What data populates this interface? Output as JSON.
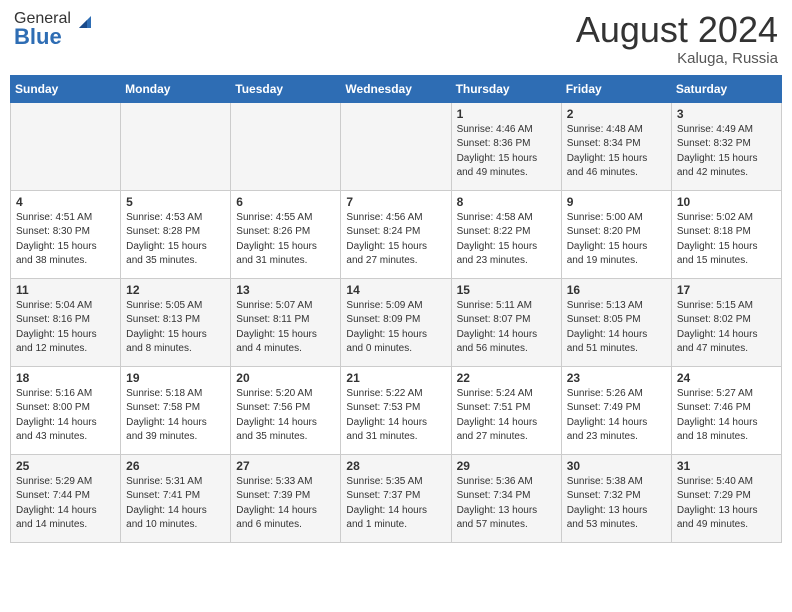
{
  "header": {
    "logo_line1": "General",
    "logo_line2": "Blue",
    "month_title": "August 2024",
    "location": "Kaluga, Russia"
  },
  "weekdays": [
    "Sunday",
    "Monday",
    "Tuesday",
    "Wednesday",
    "Thursday",
    "Friday",
    "Saturday"
  ],
  "weeks": [
    [
      {
        "day": "",
        "info": ""
      },
      {
        "day": "",
        "info": ""
      },
      {
        "day": "",
        "info": ""
      },
      {
        "day": "",
        "info": ""
      },
      {
        "day": "1",
        "info": "Sunrise: 4:46 AM\nSunset: 8:36 PM\nDaylight: 15 hours\nand 49 minutes."
      },
      {
        "day": "2",
        "info": "Sunrise: 4:48 AM\nSunset: 8:34 PM\nDaylight: 15 hours\nand 46 minutes."
      },
      {
        "day": "3",
        "info": "Sunrise: 4:49 AM\nSunset: 8:32 PM\nDaylight: 15 hours\nand 42 minutes."
      }
    ],
    [
      {
        "day": "4",
        "info": "Sunrise: 4:51 AM\nSunset: 8:30 PM\nDaylight: 15 hours\nand 38 minutes."
      },
      {
        "day": "5",
        "info": "Sunrise: 4:53 AM\nSunset: 8:28 PM\nDaylight: 15 hours\nand 35 minutes."
      },
      {
        "day": "6",
        "info": "Sunrise: 4:55 AM\nSunset: 8:26 PM\nDaylight: 15 hours\nand 31 minutes."
      },
      {
        "day": "7",
        "info": "Sunrise: 4:56 AM\nSunset: 8:24 PM\nDaylight: 15 hours\nand 27 minutes."
      },
      {
        "day": "8",
        "info": "Sunrise: 4:58 AM\nSunset: 8:22 PM\nDaylight: 15 hours\nand 23 minutes."
      },
      {
        "day": "9",
        "info": "Sunrise: 5:00 AM\nSunset: 8:20 PM\nDaylight: 15 hours\nand 19 minutes."
      },
      {
        "day": "10",
        "info": "Sunrise: 5:02 AM\nSunset: 8:18 PM\nDaylight: 15 hours\nand 15 minutes."
      }
    ],
    [
      {
        "day": "11",
        "info": "Sunrise: 5:04 AM\nSunset: 8:16 PM\nDaylight: 15 hours\nand 12 minutes."
      },
      {
        "day": "12",
        "info": "Sunrise: 5:05 AM\nSunset: 8:13 PM\nDaylight: 15 hours\nand 8 minutes."
      },
      {
        "day": "13",
        "info": "Sunrise: 5:07 AM\nSunset: 8:11 PM\nDaylight: 15 hours\nand 4 minutes."
      },
      {
        "day": "14",
        "info": "Sunrise: 5:09 AM\nSunset: 8:09 PM\nDaylight: 15 hours\nand 0 minutes."
      },
      {
        "day": "15",
        "info": "Sunrise: 5:11 AM\nSunset: 8:07 PM\nDaylight: 14 hours\nand 56 minutes."
      },
      {
        "day": "16",
        "info": "Sunrise: 5:13 AM\nSunset: 8:05 PM\nDaylight: 14 hours\nand 51 minutes."
      },
      {
        "day": "17",
        "info": "Sunrise: 5:15 AM\nSunset: 8:02 PM\nDaylight: 14 hours\nand 47 minutes."
      }
    ],
    [
      {
        "day": "18",
        "info": "Sunrise: 5:16 AM\nSunset: 8:00 PM\nDaylight: 14 hours\nand 43 minutes."
      },
      {
        "day": "19",
        "info": "Sunrise: 5:18 AM\nSunset: 7:58 PM\nDaylight: 14 hours\nand 39 minutes."
      },
      {
        "day": "20",
        "info": "Sunrise: 5:20 AM\nSunset: 7:56 PM\nDaylight: 14 hours\nand 35 minutes."
      },
      {
        "day": "21",
        "info": "Sunrise: 5:22 AM\nSunset: 7:53 PM\nDaylight: 14 hours\nand 31 minutes."
      },
      {
        "day": "22",
        "info": "Sunrise: 5:24 AM\nSunset: 7:51 PM\nDaylight: 14 hours\nand 27 minutes."
      },
      {
        "day": "23",
        "info": "Sunrise: 5:26 AM\nSunset: 7:49 PM\nDaylight: 14 hours\nand 23 minutes."
      },
      {
        "day": "24",
        "info": "Sunrise: 5:27 AM\nSunset: 7:46 PM\nDaylight: 14 hours\nand 18 minutes."
      }
    ],
    [
      {
        "day": "25",
        "info": "Sunrise: 5:29 AM\nSunset: 7:44 PM\nDaylight: 14 hours\nand 14 minutes."
      },
      {
        "day": "26",
        "info": "Sunrise: 5:31 AM\nSunset: 7:41 PM\nDaylight: 14 hours\nand 10 minutes."
      },
      {
        "day": "27",
        "info": "Sunrise: 5:33 AM\nSunset: 7:39 PM\nDaylight: 14 hours\nand 6 minutes."
      },
      {
        "day": "28",
        "info": "Sunrise: 5:35 AM\nSunset: 7:37 PM\nDaylight: 14 hours\nand 1 minute."
      },
      {
        "day": "29",
        "info": "Sunrise: 5:36 AM\nSunset: 7:34 PM\nDaylight: 13 hours\nand 57 minutes."
      },
      {
        "day": "30",
        "info": "Sunrise: 5:38 AM\nSunset: 7:32 PM\nDaylight: 13 hours\nand 53 minutes."
      },
      {
        "day": "31",
        "info": "Sunrise: 5:40 AM\nSunset: 7:29 PM\nDaylight: 13 hours\nand 49 minutes."
      }
    ]
  ]
}
